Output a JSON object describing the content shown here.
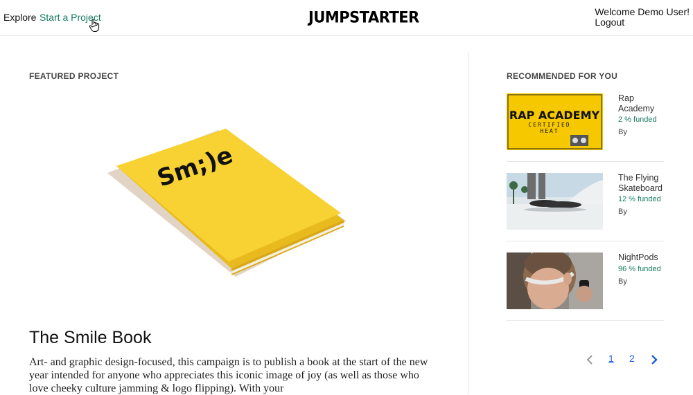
{
  "header": {
    "explore_label": "Explore",
    "start_project_label": "Start a Project",
    "logo_text": "JUMPSTARTER",
    "welcome_text": "Welcome Demo User!",
    "logout_label": "Logout"
  },
  "featured": {
    "section_label": "FEATURED PROJECT",
    "cover_text": "Sm;)e",
    "title": "The Smile Book",
    "description": "Art- and graphic design-focused, this campaign is to publish a book at the start of the new year intended for anyone who appreciates this iconic image of joy (as well as those who love cheeky culture jamming & logo flipping). With your"
  },
  "recommended": {
    "section_label": "RECOMMENDED FOR YOU",
    "items": [
      {
        "title": "Rap Academy",
        "funded": "2 % funded",
        "by": "By",
        "thumb_line1": "RAP ACADEMY",
        "thumb_line2": "CERTIFIED",
        "thumb_line3": "HEAT"
      },
      {
        "title": "The Flying Skateboard",
        "funded": "12 % funded",
        "by": "By"
      },
      {
        "title": "NightPods",
        "funded": "96 % funded",
        "by": "By"
      }
    ]
  },
  "pagination": {
    "prev": "‹",
    "pages": [
      "1",
      "2"
    ],
    "next": "›"
  },
  "colors": {
    "accent_green": "#147b5f",
    "link_blue": "#1a5fd1",
    "book_yellow": "#f7d232"
  }
}
